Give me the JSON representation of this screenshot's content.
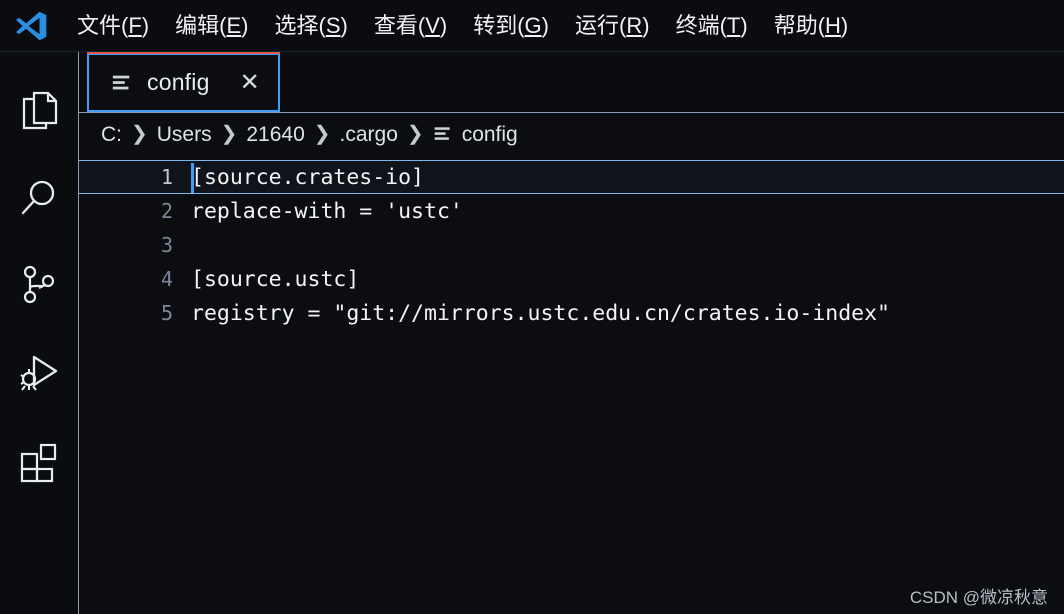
{
  "colors": {
    "background": "#0b0d11",
    "chrome": "#0a0c10",
    "accent_blue": "#3f9dfb",
    "tab_top_indicator": "#e05b4b",
    "border_gray": "#8d9bb0",
    "active_line_border": "#79b8e8",
    "text": "#f2f4f7",
    "line_number": "#7c8697",
    "logo_blue": "#2a8fe0"
  },
  "menubar": {
    "logo_name": "vscode-logo",
    "items": [
      {
        "label": "文件",
        "mnemonic": "F"
      },
      {
        "label": "编辑",
        "mnemonic": "E"
      },
      {
        "label": "选择",
        "mnemonic": "S"
      },
      {
        "label": "查看",
        "mnemonic": "V"
      },
      {
        "label": "转到",
        "mnemonic": "G"
      },
      {
        "label": "运行",
        "mnemonic": "R"
      },
      {
        "label": "终端",
        "mnemonic": "T"
      },
      {
        "label": "帮助",
        "mnemonic": "H"
      }
    ]
  },
  "activitybar": {
    "items": [
      {
        "icon": "files-explorer-icon",
        "title": "资源管理器"
      },
      {
        "icon": "search-icon",
        "title": "搜索"
      },
      {
        "icon": "source-control-branch-icon",
        "title": "源代码管理"
      },
      {
        "icon": "run-and-debug-icon",
        "title": "运行和调试"
      },
      {
        "icon": "extensions-icon",
        "title": "扩展"
      }
    ]
  },
  "tabs": [
    {
      "label": "config",
      "icon": "config-file-icon",
      "close_glyph": "✕",
      "active": true
    }
  ],
  "breadcrumbs": {
    "separator": "❯",
    "items": [
      {
        "label": "C:",
        "icon": null
      },
      {
        "label": "Users",
        "icon": null
      },
      {
        "label": "21640",
        "icon": null
      },
      {
        "label": ".cargo",
        "icon": null
      },
      {
        "label": "config",
        "icon": "config-file-icon"
      }
    ]
  },
  "editor": {
    "language": "toml",
    "cursor_line": 1,
    "cursor_column": 1,
    "lines": [
      {
        "number": "1",
        "text": "[source.crates-io]"
      },
      {
        "number": "2",
        "text": "replace-with = 'ustc'"
      },
      {
        "number": "3",
        "text": ""
      },
      {
        "number": "4",
        "text": "[source.ustc]"
      },
      {
        "number": "5",
        "text": "registry = \"git://mirrors.ustc.edu.cn/crates.io-index\""
      }
    ]
  },
  "watermark": {
    "text": "CSDN @微凉秋意"
  }
}
